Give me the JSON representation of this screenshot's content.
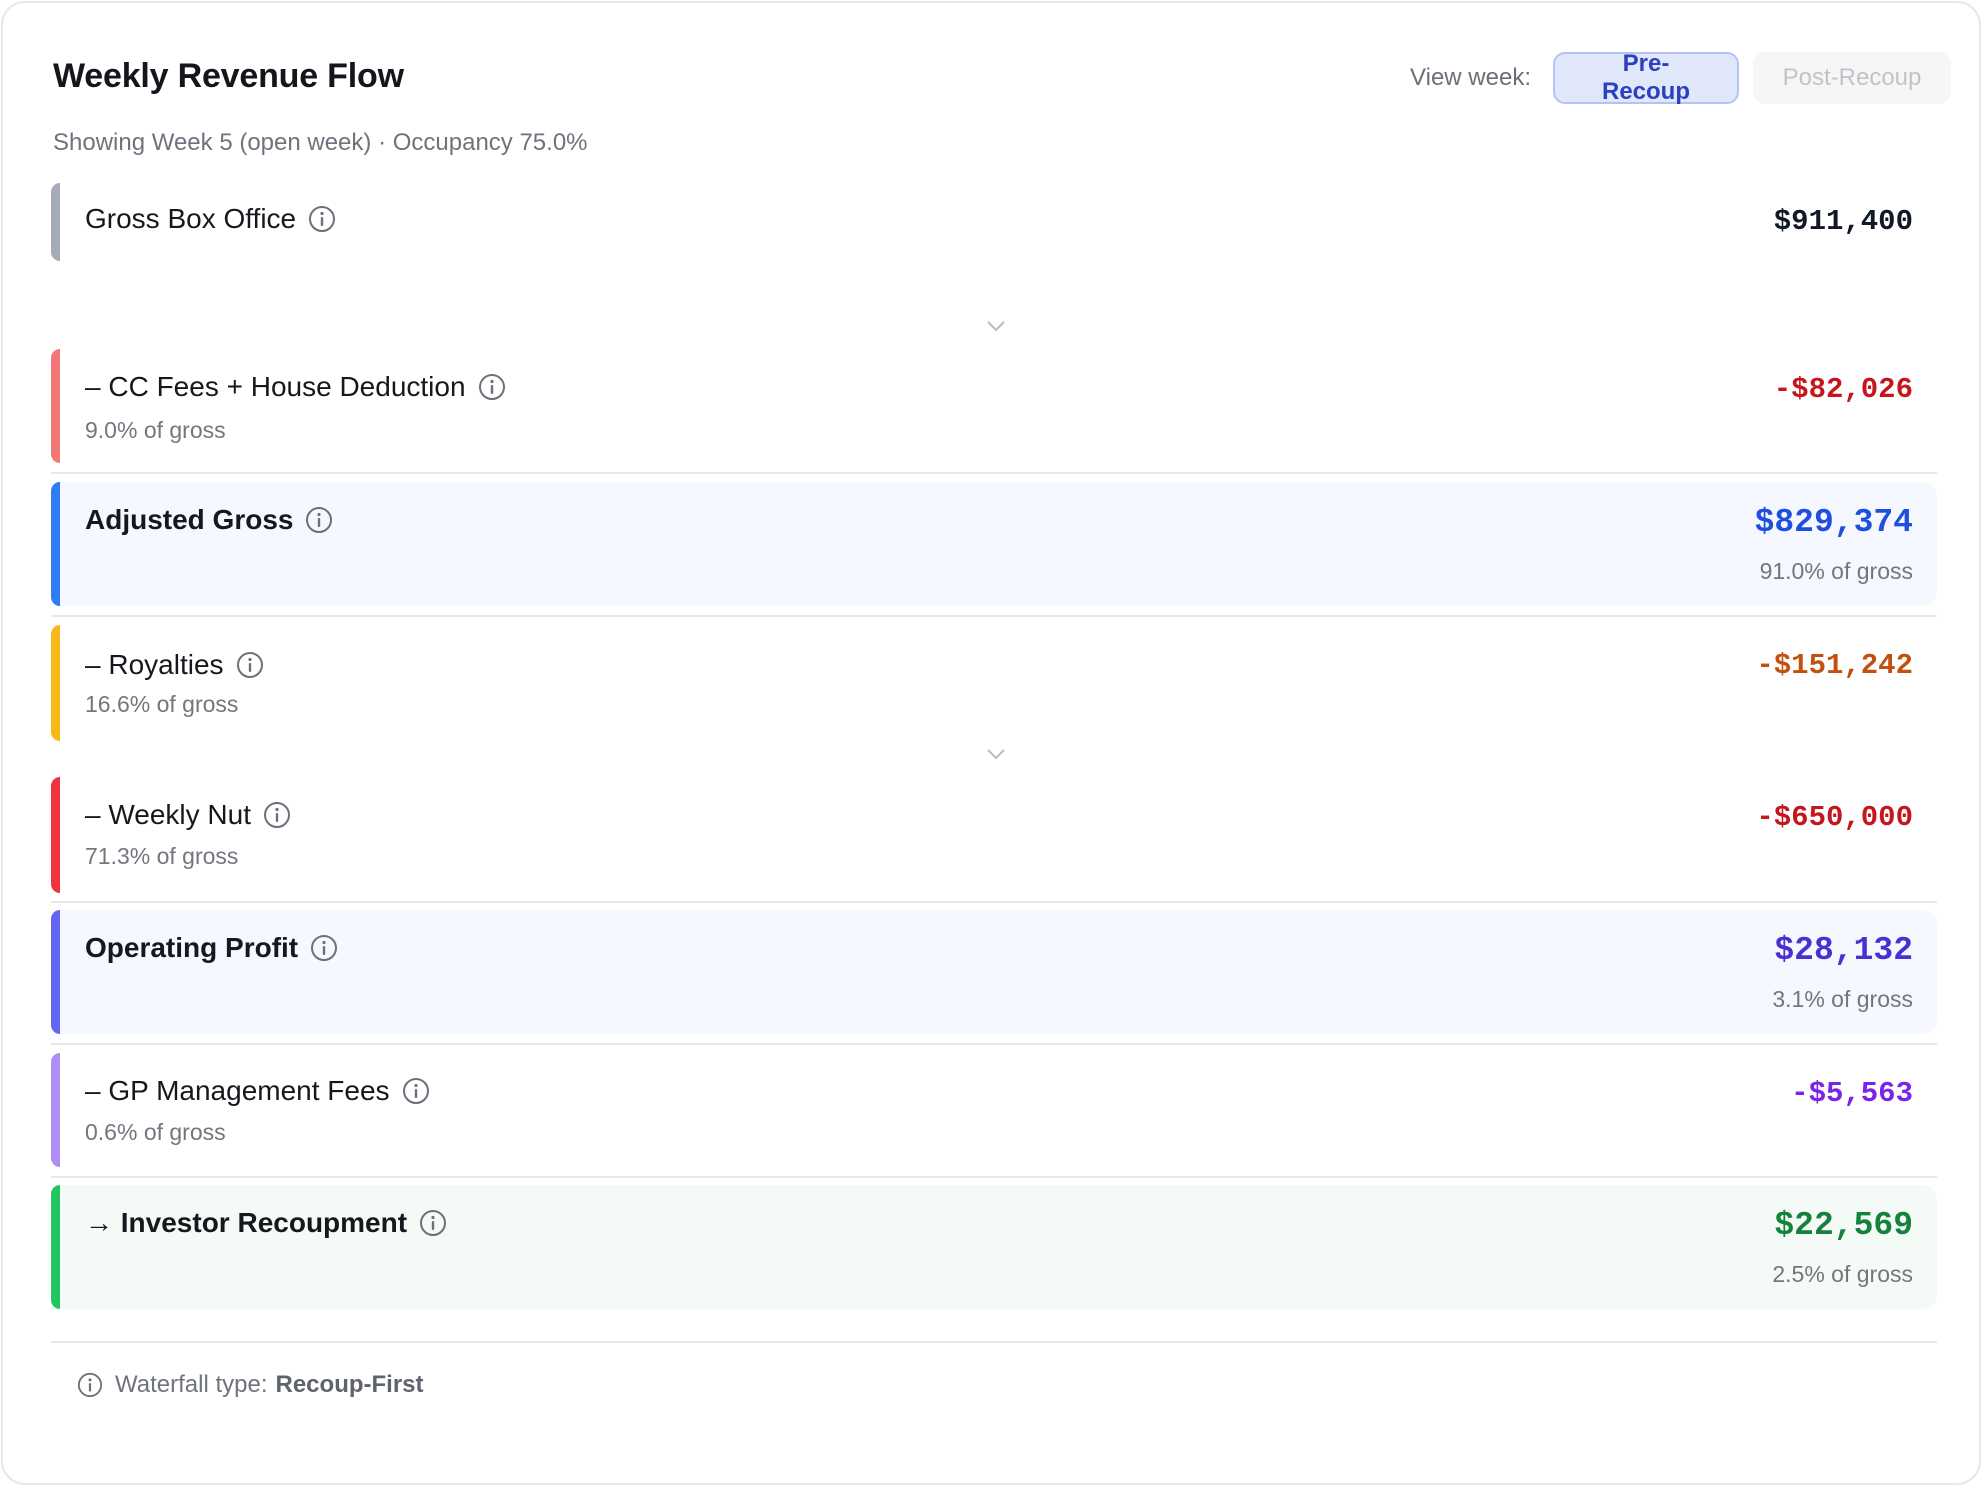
{
  "header": {
    "title": "Weekly Revenue Flow",
    "subtitle": "Showing Week 5 (open week) · Occupancy 75.0%"
  },
  "view_week": {
    "label": "View week:",
    "options": [
      {
        "label": "Pre-Recoup",
        "state": "selected"
      },
      {
        "label": "Post-Recoup",
        "state": "disabled"
      }
    ]
  },
  "rows": [
    {
      "label": "Gross Box Office",
      "sub": "",
      "value": "$911,400",
      "color": "#a5acb8",
      "value_color": "#111827",
      "highlight": false
    },
    {
      "label": "– CC Fees + House Deduction",
      "sub": "9.0% of gross",
      "value": "-$82,026",
      "color": "#f27676",
      "value_color": "#c4161c",
      "highlight": false
    },
    {
      "label": "Adjusted Gross",
      "sub": "91.0% of gross",
      "value": "$829,374",
      "color": "#2f7cf6",
      "value_color": "#1f4fdc",
      "highlight": true
    },
    {
      "label": "– Royalties",
      "sub": "16.6% of gross",
      "value": "-$151,242",
      "color": "#f7b919",
      "value_color": "#c2510e",
      "highlight": false
    },
    {
      "label": "– Weekly Nut",
      "sub": "71.3% of gross",
      "value": "-$650,000",
      "color": "#ef3340",
      "value_color": "#c4161c",
      "highlight": false
    },
    {
      "label": "Operating Profit",
      "sub": "3.1% of gross",
      "value": "$28,132",
      "color": "#6366f1",
      "value_color": "#4a30d2",
      "highlight": true
    },
    {
      "label": "– GP Management Fees",
      "sub": "0.6% of gross",
      "value": "-$5,563",
      "color": "#b08cf7",
      "value_color": "#7b23e8",
      "highlight": false
    },
    {
      "label": "→ Investor Recoupment",
      "sub": "2.5% of gross",
      "value": "$22,569",
      "color": "#22c55e",
      "value_color": "#16813d",
      "highlight": true
    }
  ],
  "footer": {
    "label": "Waterfall type:",
    "value": "Recoup-First"
  },
  "icons": {
    "info": "info-circle-icon",
    "chevron": "chevron-down-icon"
  }
}
